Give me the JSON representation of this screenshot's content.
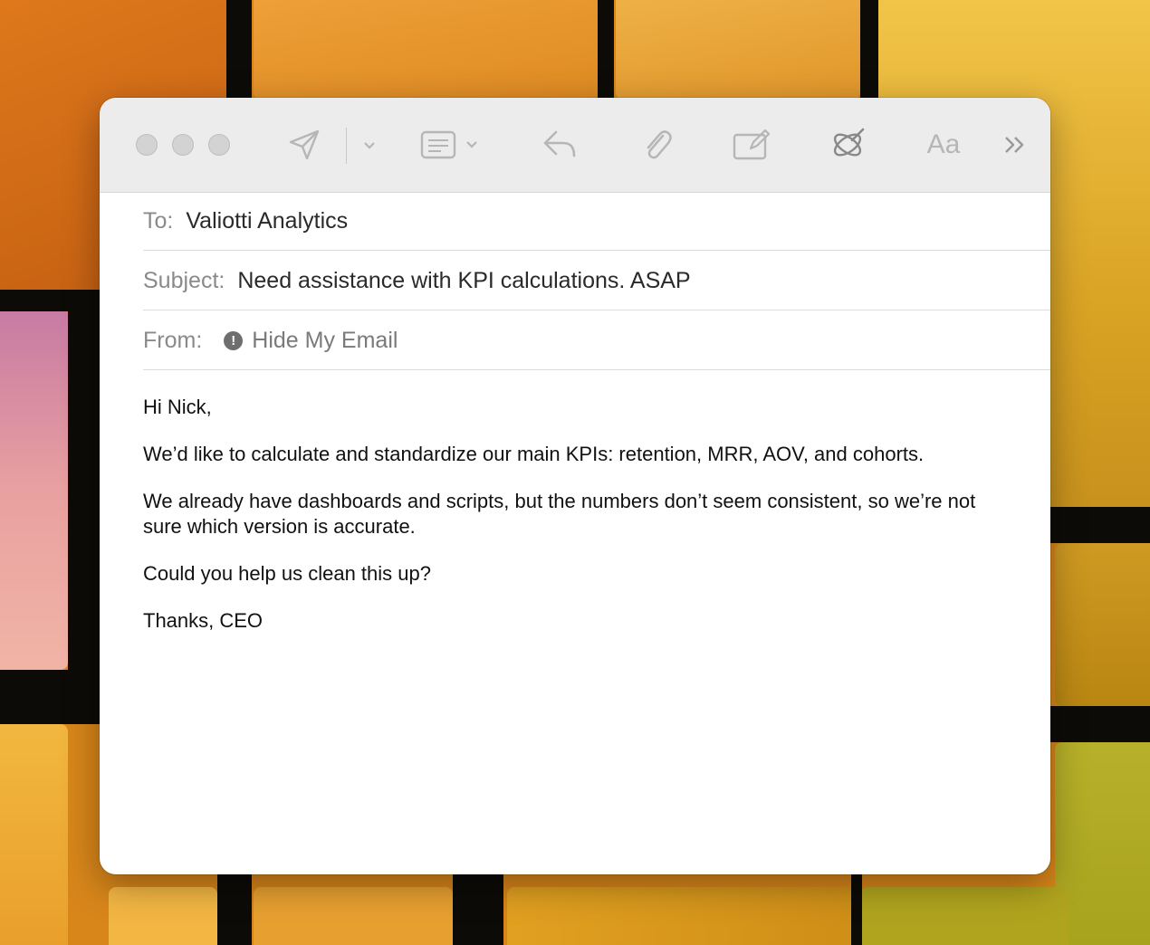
{
  "toolbar": {
    "icons": [
      "send-icon",
      "chevron-down-icon",
      "header-fields-icon",
      "reply-icon",
      "paperclip-icon",
      "markup-icon",
      "writing-tools-icon",
      "format-text-icon",
      "more-icon"
    ],
    "format_label": "Aa",
    "more_label": "»"
  },
  "header": {
    "to_label": "To:",
    "to_value": "Valiotti Analytics",
    "subject_label": "Subject:",
    "subject_value": "Need assistance with KPI calculations. ASAP",
    "from_label": "From:",
    "from_value": "Hide My Email"
  },
  "message": {
    "greeting": "Hi Nick,",
    "para1": "We’d like to calculate and standardize our main KPIs: retention, MRR, AOV, and cohorts.",
    "para2": "We already have dashboards and scripts, but the numbers don’t seem consistent, so we’re not sure which version is accurate.",
    "para3": "Could you help us clean this up?",
    "signoff": "Thanks, CEO"
  },
  "colors": {
    "toolbar_bg": "#ececec",
    "window_bg": "#ffffff",
    "icon_gray": "#b6b6b6",
    "label_gray": "#8a8a8a"
  }
}
